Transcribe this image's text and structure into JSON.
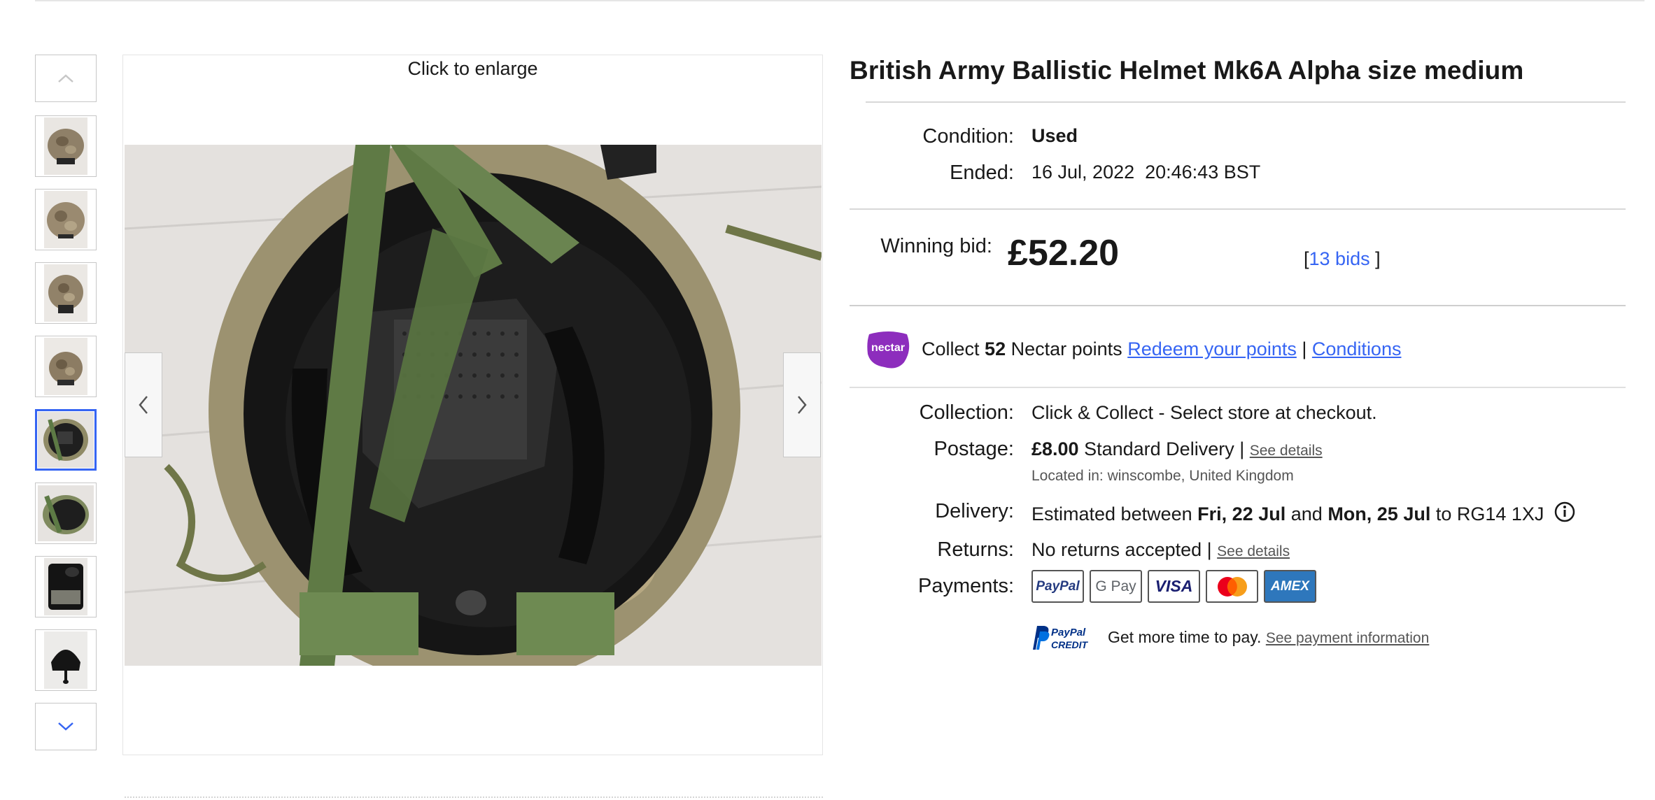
{
  "viewer": {
    "enlarge_text": "Click to enlarge"
  },
  "listing": {
    "title": "British Army Ballistic Helmet Mk6A Alpha size medium",
    "condition_label": "Condition:",
    "condition_value": "Used",
    "ended_label": "Ended:",
    "ended_value": "16 Jul, 2022  20:46:43 BST",
    "winning_bid_label": "Winning bid:",
    "winning_bid_value": "£52.20",
    "bids_open": "[",
    "bids_link": "13 bids",
    "bids_close": "]"
  },
  "nectar": {
    "logo_text": "nectar",
    "collect_prefix": "Collect",
    "points": "52",
    "collect_suffix": "Nectar points",
    "redeem_link": "Redeem your points",
    "separator": "|",
    "conditions_link": "Conditions"
  },
  "shipping": {
    "collection_label": "Collection:",
    "collection_value": "Click & Collect - Select store at checkout.",
    "postage_label": "Postage:",
    "postage_price": "£8.00",
    "postage_method": "Standard Delivery |",
    "postage_details_link": "See details",
    "located_in": "Located in: winscombe, United Kingdom",
    "delivery_label": "Delivery:",
    "delivery_prefix": "Estimated between",
    "delivery_from": "Fri, 22 Jul",
    "delivery_and": "and",
    "delivery_to": "Mon, 25 Jul",
    "delivery_postcode": "to RG14 1XJ",
    "returns_label": "Returns:",
    "returns_value": "No returns accepted |",
    "returns_details_link": "See details",
    "payments_label": "Payments:"
  },
  "payments": {
    "methods": [
      "PayPal",
      "G Pay",
      "VISA",
      "Mastercard",
      "AMEX"
    ],
    "paypal_credit_line1": "PayPal",
    "paypal_credit_line2": "CREDIT",
    "credit_text": "Get more time to pay.",
    "credit_link": "See payment information"
  },
  "icons": {
    "up": "chevron-up-icon",
    "down": "chevron-down-icon",
    "prev": "chevron-left-icon",
    "next": "chevron-right-icon",
    "info": "info-icon"
  },
  "colors": {
    "link": "#3665f3",
    "nectar": "#8d2dbd",
    "amex": "#2e77bc"
  }
}
